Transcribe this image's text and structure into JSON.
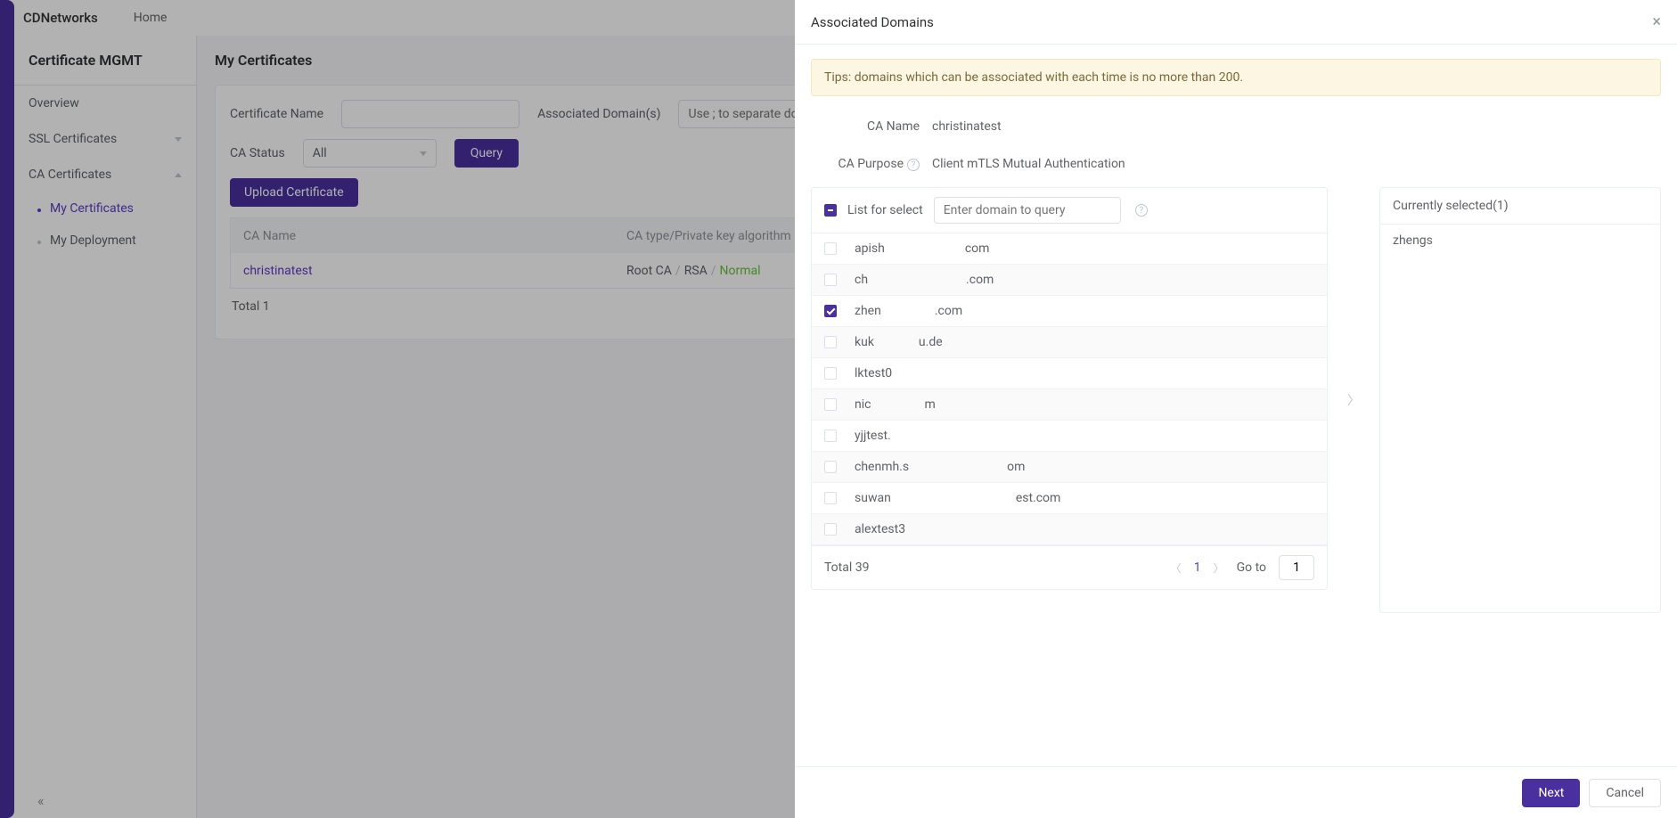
{
  "brand": "CDNetworks",
  "nav_home": "Home",
  "sidebar": {
    "title": "Certificate MGMT",
    "items": [
      {
        "label": "Overview"
      },
      {
        "label": "SSL Certificates"
      },
      {
        "label": "CA Certificates"
      }
    ],
    "subs": [
      {
        "label": "My Certificates"
      },
      {
        "label": "My Deployment"
      }
    ]
  },
  "main": {
    "title": "My Certificates",
    "filters": {
      "cert_name_label": "Certificate Name",
      "assoc_label": "Associated Domain(s)",
      "assoc_placeholder": "Use ; to separate domains",
      "status_label": "CA Status",
      "status_value": "All",
      "query_btn": "Query"
    },
    "upload_btn": "Upload Certificate",
    "columns": {
      "a": "CA Name",
      "b": "CA type/Private key algorithm"
    },
    "row": {
      "name": "christinatest",
      "type": "Root CA",
      "algo": "RSA",
      "status": "Normal"
    },
    "total": "Total 1"
  },
  "drawer": {
    "title": "Associated Domains",
    "tip": "Tips: domains which can be associated with each time is no more than 200.",
    "ca_name_label": "CA Name",
    "ca_name_value": "christinatest",
    "ca_purpose_label": "CA Purpose",
    "ca_purpose_value": "Client mTLS Mutual Authentication",
    "list_label": "List for select",
    "domain_placeholder": "Enter domain to query",
    "domains": [
      {
        "pre": "apish",
        "post": "com",
        "redact_w": 90,
        "checked": false
      },
      {
        "pre": "ch",
        "post": ".com",
        "redact_w": 110,
        "checked": false
      },
      {
        "pre": "zhen",
        "post": ".com",
        "redact_w": 60,
        "checked": true
      },
      {
        "pre": "kuk",
        "post": "u.de",
        "redact_w": 50,
        "checked": false
      },
      {
        "pre": "lktest0",
        "post": "",
        "redact_w": 50,
        "checked": false
      },
      {
        "pre": "nic",
        "post": "m",
        "redact_w": 60,
        "checked": false
      },
      {
        "pre": "yjjtest.",
        "post": "",
        "redact_w": 60,
        "checked": false
      },
      {
        "pre": "chenmh.s",
        "post": "om",
        "redact_w": 110,
        "checked": false
      },
      {
        "pre": "suwan",
        "post": "est.com",
        "redact_w": 140,
        "checked": false
      },
      {
        "pre": "alextest3",
        "post": "",
        "redact_w": 100,
        "checked": false
      }
    ],
    "list_total": "Total 39",
    "page_current": "1",
    "goto_label": "Go to",
    "goto_value": "1",
    "selected_title": "Currently selected(1)",
    "selected_item_pre": "zhengs",
    "selected_item_redact_w": 60,
    "next_btn": "Next",
    "cancel_btn": "Cancel"
  }
}
